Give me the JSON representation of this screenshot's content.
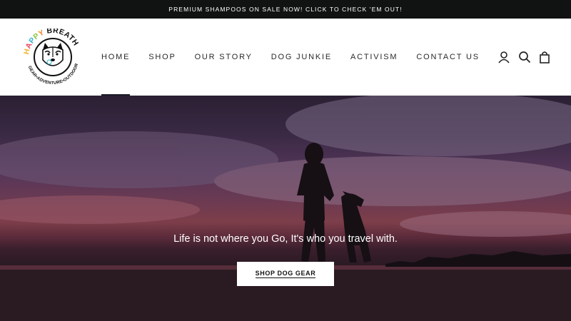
{
  "announcement": {
    "text": "PREMIUM SHAMPOOS ON SALE NOW! CLICK TO CHECK 'EM OUT!"
  },
  "logo": {
    "top_text": "HAPPY BREATH",
    "bottom_text": "GEAR•ADVENTURE•OUTDOOR",
    "colors": {
      "h": "#f2b632",
      "a": "#e84a5f",
      "p1": "#2fb6d1",
      "p2": "#8cc63f",
      "y": "#f58220"
    }
  },
  "nav": {
    "items": [
      {
        "label": "HOME",
        "active": true
      },
      {
        "label": "SHOP"
      },
      {
        "label": "OUR STORY"
      },
      {
        "label": "DOG JUNKIE"
      },
      {
        "label": "ACTIVISM"
      },
      {
        "label": "CONTACT US"
      }
    ]
  },
  "header_icons": [
    "account-icon",
    "search-icon",
    "cart-icon"
  ],
  "hero": {
    "tagline": "Life is not where you Go, It's who you travel with.",
    "cta_label": "SHOP DOG GEAR"
  }
}
